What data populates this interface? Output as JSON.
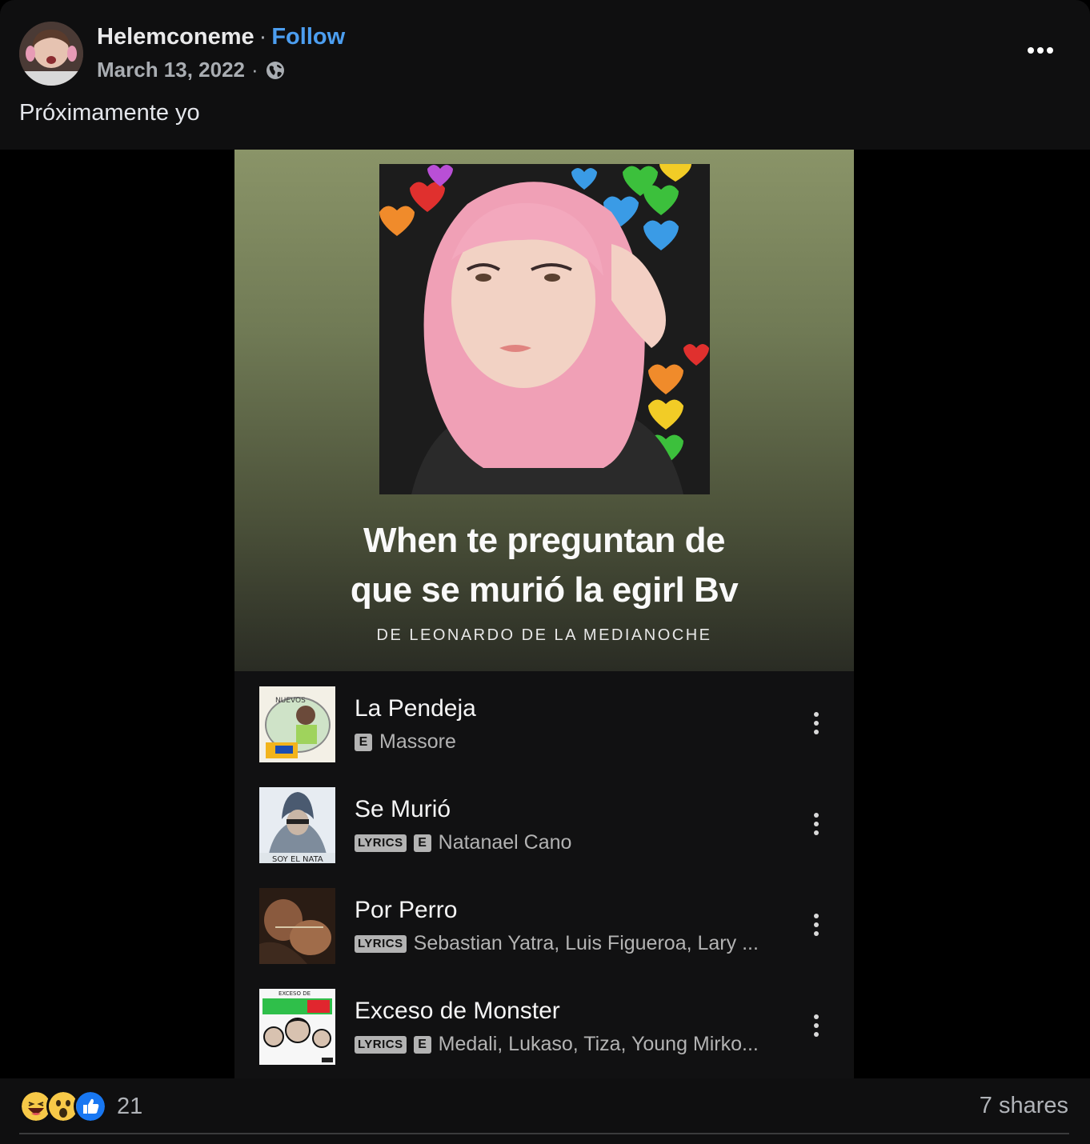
{
  "post": {
    "author": "Helemconeme",
    "separator": "·",
    "follow_label": "Follow",
    "date": "March 13, 2022",
    "meta_separator": "·",
    "audience_icon": "globe-icon",
    "caption": "Próximamente yo"
  },
  "playlist": {
    "title_line1": "When te preguntan de",
    "title_line2": "que se murió la egirl Bv",
    "owner": "DE LEONARDO DE LA MEDIANOCHE",
    "tracks": [
      {
        "title": "La Pendeja",
        "explicit": "E",
        "lyrics": "",
        "artists": "Massore"
      },
      {
        "title": "Se Murió",
        "explicit": "E",
        "lyrics": "LYRICS",
        "artists": "Natanael Cano"
      },
      {
        "title": "Por Perro",
        "explicit": "",
        "lyrics": "LYRICS",
        "artists": "Sebastian Yatra, Luis Figueroa, Lary ..."
      },
      {
        "title": "Exceso de Monster",
        "explicit": "E",
        "lyrics": "LYRICS",
        "artists": "Medali, Lukaso, Tiza, Young Mirko..."
      }
    ],
    "album_art_text": {
      "track1_art_text": "NUEVOS",
      "track2_art_text": "SOY EL NATA",
      "track4_art_text": "EXCESO DE"
    }
  },
  "footer": {
    "reaction_count": "21",
    "shares": "7 shares",
    "reaction_icons": [
      "haha-icon",
      "wow-icon",
      "like-icon"
    ]
  },
  "colors": {
    "link": "#4c9ef0",
    "background": "#000000",
    "card": "#0f0f10"
  }
}
